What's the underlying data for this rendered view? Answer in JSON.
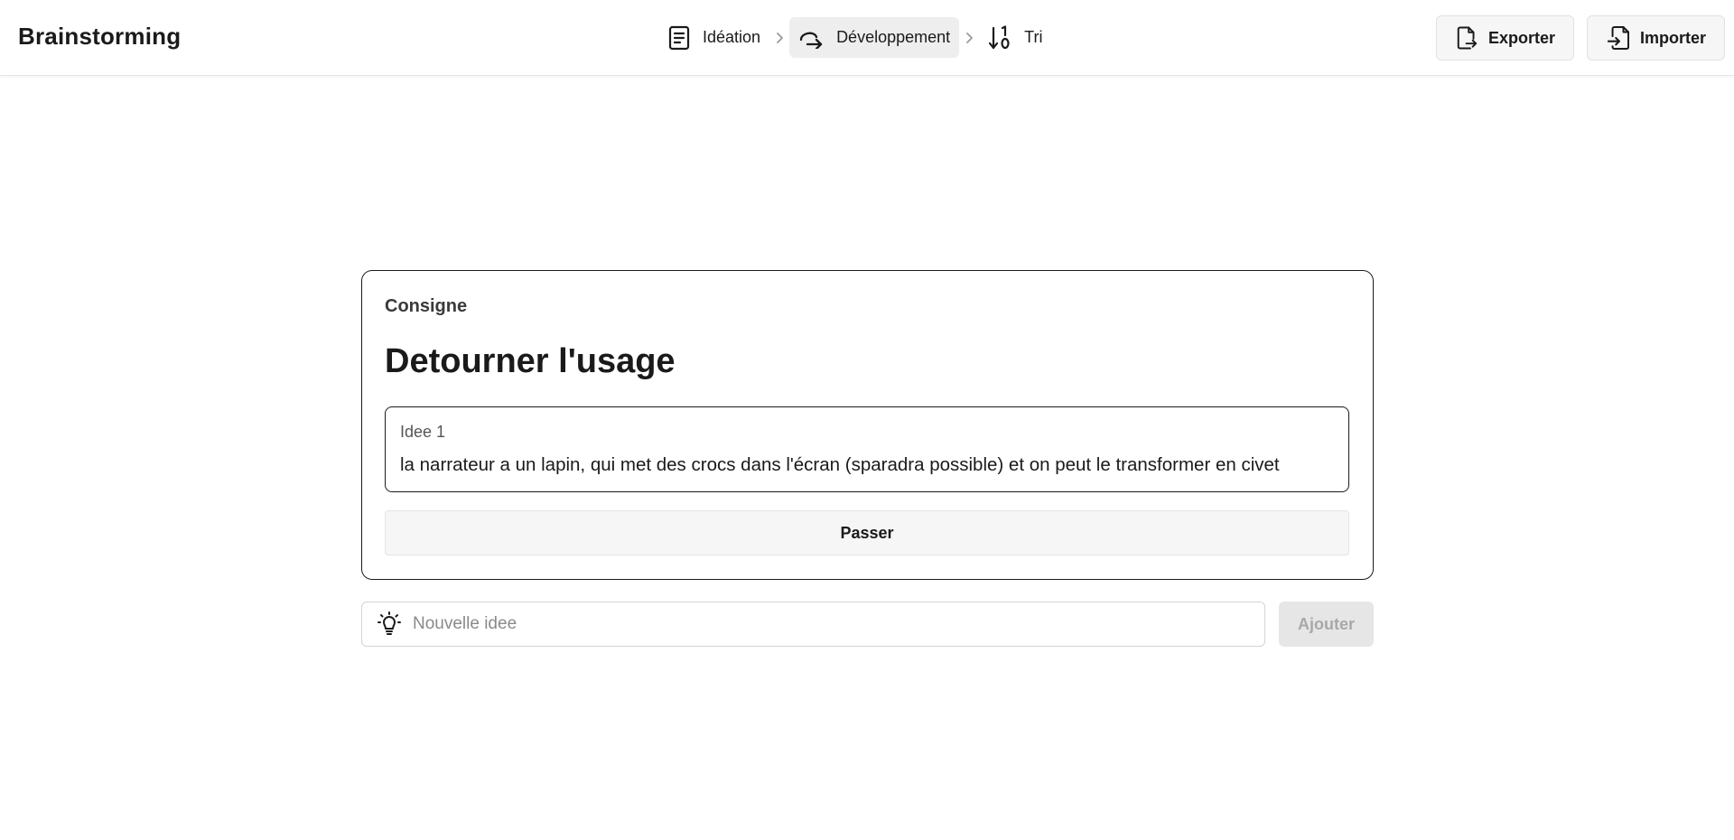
{
  "header": {
    "app_title": "Brainstorming",
    "steps": [
      {
        "label": "Idéation",
        "icon": "document-icon",
        "active": false
      },
      {
        "label": "Développement",
        "icon": "redo-arrow-icon",
        "active": true
      },
      {
        "label": "Tri",
        "icon": "sort-numeric-icon",
        "active": false
      }
    ],
    "export_label": "Exporter",
    "import_label": "Importer"
  },
  "card": {
    "label": "Consigne",
    "title": "Detourner l'usage",
    "idea": {
      "label": "Idee 1",
      "text": "la narrateur a un lapin, qui met des crocs dans l'écran (sparadra possible) et on peut le transformer en civet"
    },
    "skip_label": "Passer"
  },
  "new_idea": {
    "placeholder": "Nouvelle idee",
    "icon": "lightbulb-icon",
    "add_label": "Ajouter"
  }
}
